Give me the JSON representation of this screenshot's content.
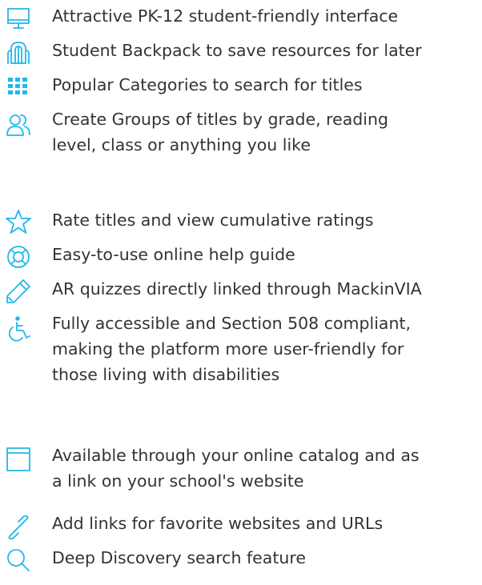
{
  "accent_color": "#21b8e8",
  "text_color": "#333333",
  "features": [
    {
      "icon": "monitor-icon",
      "lines": [
        "Attractive PK-12 student-friendly interface"
      ]
    },
    {
      "icon": "backpack-icon",
      "lines": [
        "Student Backpack to save resources for later"
      ]
    },
    {
      "icon": "grid-icon",
      "lines": [
        "Popular Categories to search for titles"
      ]
    },
    {
      "icon": "group-users-icon",
      "lines": [
        "Create Groups of titles by grade, reading",
        "level, class or anything you like"
      ]
    },
    {
      "icon": "star-icon",
      "lines": [
        "Rate titles and view cumulative ratings"
      ]
    },
    {
      "icon": "lifebuoy-icon",
      "lines": [
        "Easy-to-use online help guide"
      ]
    },
    {
      "icon": "pencil-icon",
      "lines": [
        "AR quizzes directly linked through MackinVIA"
      ]
    },
    {
      "icon": "accessibility-icon",
      "lines": [
        "Fully accessible and Section 508 compliant,",
        "making the platform more user-friendly for",
        "those living with disabilities"
      ]
    },
    {
      "icon": "browser-window-icon",
      "lines": [
        "Available through your online catalog and as",
        "a link on your school's website"
      ]
    },
    {
      "icon": "link-icon",
      "lines": [
        "Add links for favorite websites and URLs"
      ]
    },
    {
      "icon": "search-icon",
      "lines": [
        "Deep Discovery search feature"
      ]
    }
  ]
}
